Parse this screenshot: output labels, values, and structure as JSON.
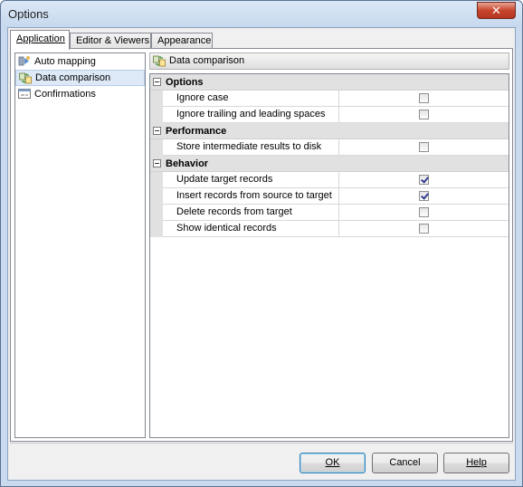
{
  "window": {
    "title": "Options",
    "close_glyph": "✕"
  },
  "tabs": [
    {
      "label": "Application",
      "active": true
    },
    {
      "label": "Editor & Viewers",
      "active": false
    },
    {
      "label": "Appearance",
      "active": false
    }
  ],
  "sidebar": {
    "items": [
      {
        "label": "Auto mapping",
        "icon": "auto-mapping-icon",
        "selected": false
      },
      {
        "label": "Data comparison",
        "icon": "data-comparison-icon",
        "selected": true
      },
      {
        "label": "Confirmations",
        "icon": "confirmations-icon",
        "selected": false
      }
    ]
  },
  "section": {
    "title": "Data comparison",
    "icon": "data-comparison-icon"
  },
  "grid": {
    "categories": [
      {
        "label": "Options",
        "rows": [
          {
            "label": "Ignore case",
            "checked": false
          },
          {
            "label": "Ignore trailing and leading spaces",
            "checked": false
          }
        ]
      },
      {
        "label": "Performance",
        "rows": [
          {
            "label": "Store intermediate results to disk",
            "checked": false
          }
        ]
      },
      {
        "label": "Behavior",
        "rows": [
          {
            "label": "Update target records",
            "checked": true
          },
          {
            "label": "Insert records from source to target",
            "checked": true
          },
          {
            "label": "Delete records from target",
            "checked": false
          },
          {
            "label": "Show identical records",
            "checked": false
          }
        ]
      }
    ]
  },
  "buttons": {
    "ok": "OK",
    "cancel": "Cancel",
    "help": "Help"
  },
  "colors": {
    "window_frame": "#c9daee",
    "selected_item": "#dde9f7",
    "category_bg": "#e1e1e1",
    "check_mark": "#333b8a"
  }
}
